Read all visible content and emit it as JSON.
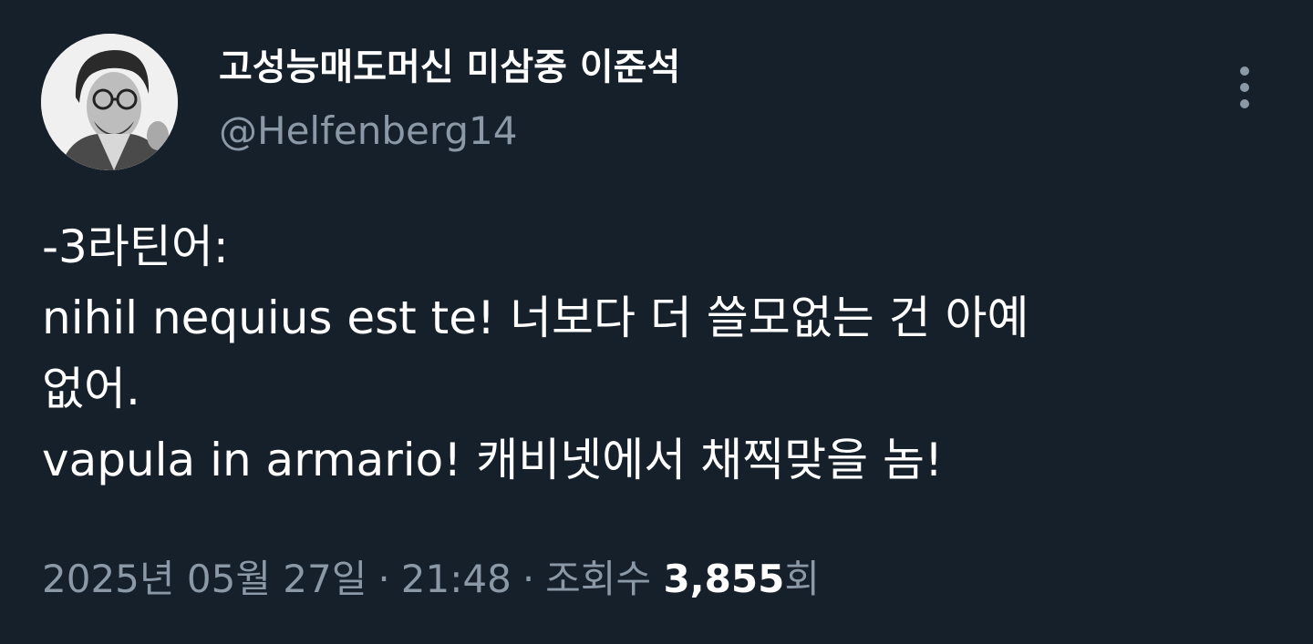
{
  "author": {
    "name": "고성능매도머신 미삼중 이준석",
    "handle": "@Helfenberg14"
  },
  "tweet": {
    "lines": [
      "-3라틴어:",
      "nihil nequius est te! 너보다 더 쓸모없는 건 아예",
      "없어.",
      "vapula in armario! 캐비넷에서 채찍맞을 놈!"
    ]
  },
  "meta": {
    "date": "2025년 05월 27일",
    "separator": "·",
    "time": "21:48",
    "views_label": "조회수",
    "views_count": "3,855",
    "views_unit": "회"
  },
  "icons": {
    "more": "more-vertical-icon"
  },
  "colors": {
    "background": "#15202b",
    "primary_text": "#ffffff",
    "secondary_text": "#8b98a5"
  }
}
